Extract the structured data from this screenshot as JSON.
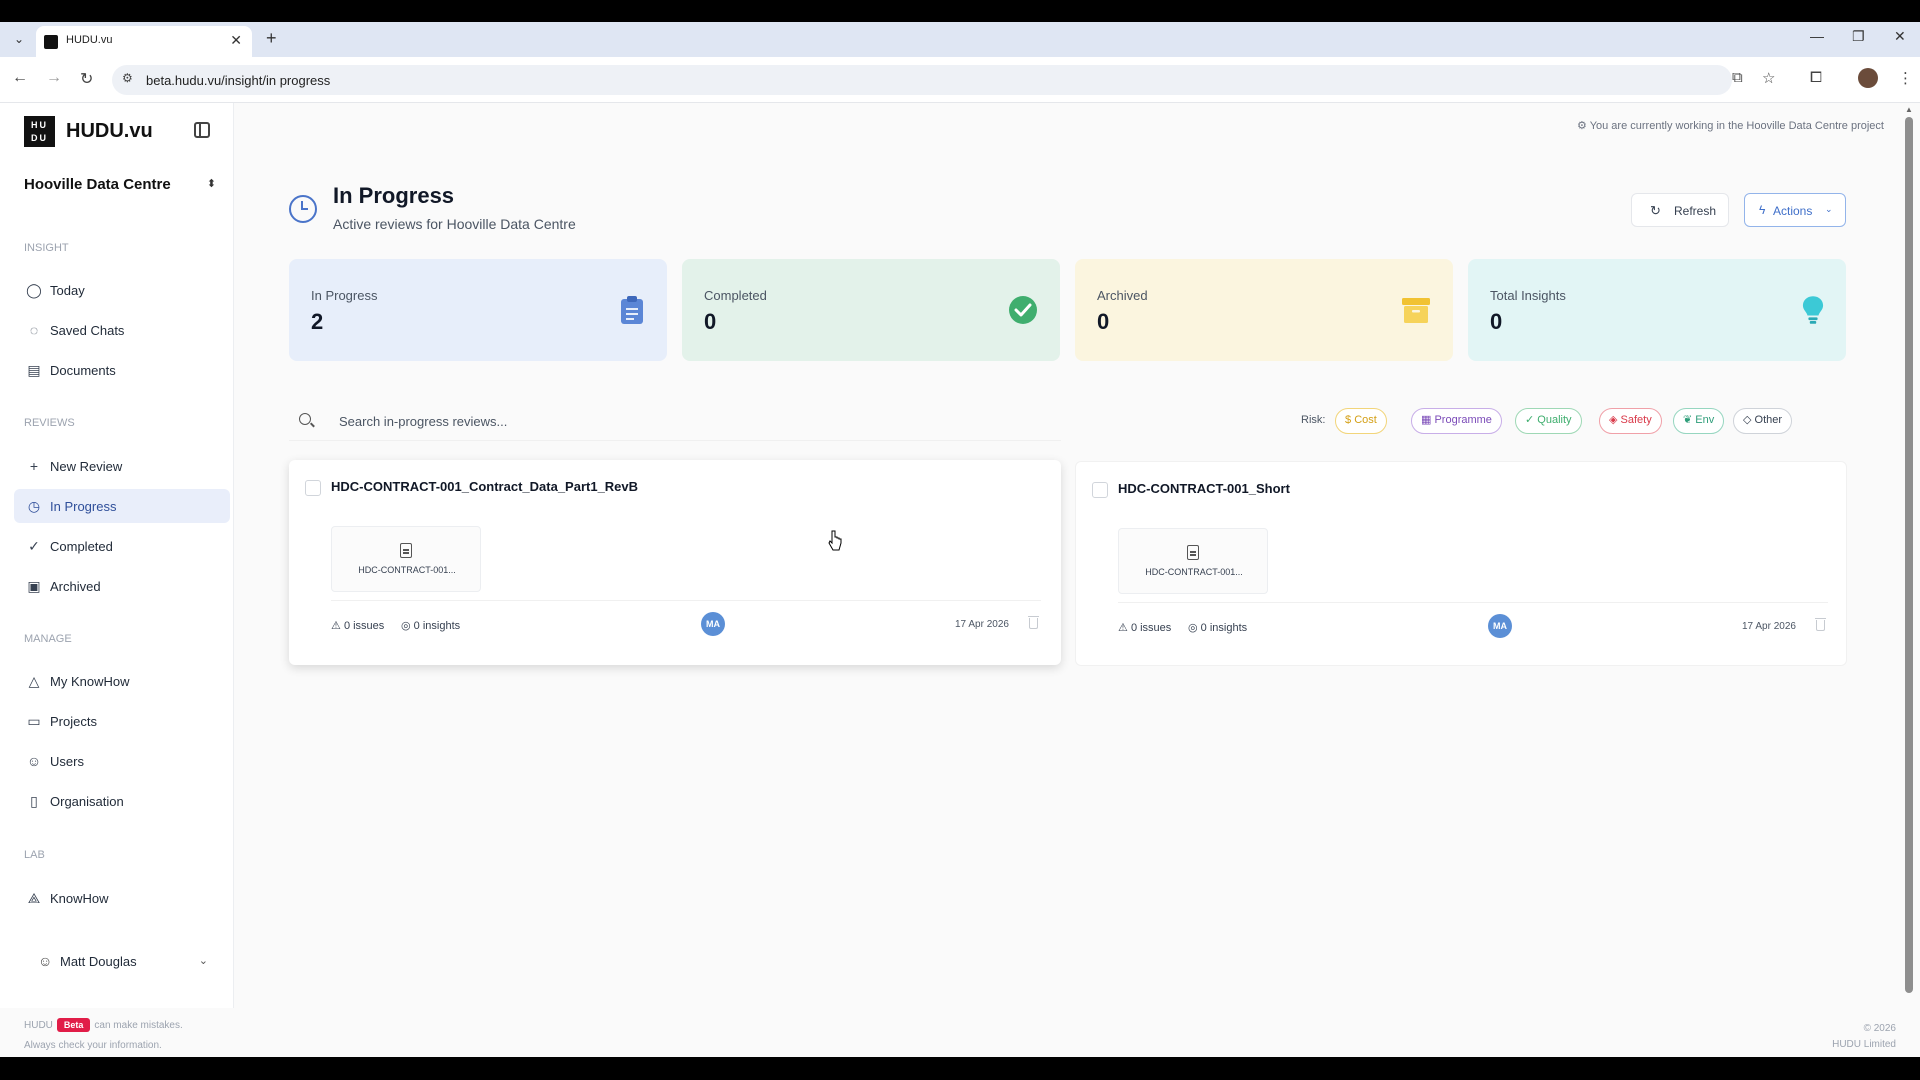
{
  "browser": {
    "tab_title": "HUDU.vu",
    "url": "beta.hudu.vu/insight/in progress"
  },
  "sidebar": {
    "logo_mark_top": "HU",
    "logo_mark_bottom": "DU",
    "logo_text": "HUDU.vu",
    "project": "Hooville Data Centre",
    "sections": {
      "insight": "INSIGHT",
      "reviews": "REVIEWS",
      "manage": "MANAGE",
      "lab": "LAB"
    },
    "items": {
      "today": "Today",
      "saved_chats": "Saved Chats",
      "documents": "Documents",
      "new_review": "New Review",
      "in_progress": "In Progress",
      "completed": "Completed",
      "archived": "Archived",
      "my_knowhow": "My KnowHow",
      "projects": "Projects",
      "users": "Users",
      "organisation": "Organisation",
      "knowhow": "KnowHow"
    },
    "user_name": "Matt Douglas"
  },
  "header": {
    "notice": "You are currently working in the Hooville Data Centre project",
    "title": "In Progress",
    "subtitle": "Active reviews for Hooville Data Centre",
    "refresh_label": "Refresh",
    "actions_label": "Actions"
  },
  "stats": [
    {
      "label": "In Progress",
      "value": "2"
    },
    {
      "label": "Completed",
      "value": "0"
    },
    {
      "label": "Archived",
      "value": "0"
    },
    {
      "label": "Total Insights",
      "value": "0"
    }
  ],
  "search": {
    "placeholder": "Search in-progress reviews..."
  },
  "risk": {
    "label": "Risk:",
    "chips": [
      "Cost",
      "Programme",
      "Quality",
      "Safety",
      "Env",
      "Other"
    ]
  },
  "reviews": [
    {
      "title": "HDC-CONTRACT-001_Contract_Data_Part1_RevB",
      "doc": "HDC-CONTRACT-001...",
      "issues": "0 issues",
      "insights": "0 insights",
      "avatar": "MA",
      "date": "17 Apr 2026"
    },
    {
      "title": "HDC-CONTRACT-001_Short",
      "doc": "HDC-CONTRACT-001...",
      "issues": "0 issues",
      "insights": "0 insights",
      "avatar": "MA",
      "date": "17 Apr 2026"
    }
  ],
  "footer": {
    "brand": "HUDU",
    "beta": "Beta",
    "mistakes": "can make mistakes.",
    "check": "Always check your information.",
    "copyright": "© 2026",
    "company": "HUDU Limited"
  },
  "colors": {
    "accent": "#3f6fc9",
    "active_nav_bg": "#e9eefa",
    "stat_in_progress": "#e7eefa",
    "stat_completed": "#e3f2ea",
    "stat_archived": "#fbf5df",
    "stat_insights": "#e2f5f5"
  }
}
